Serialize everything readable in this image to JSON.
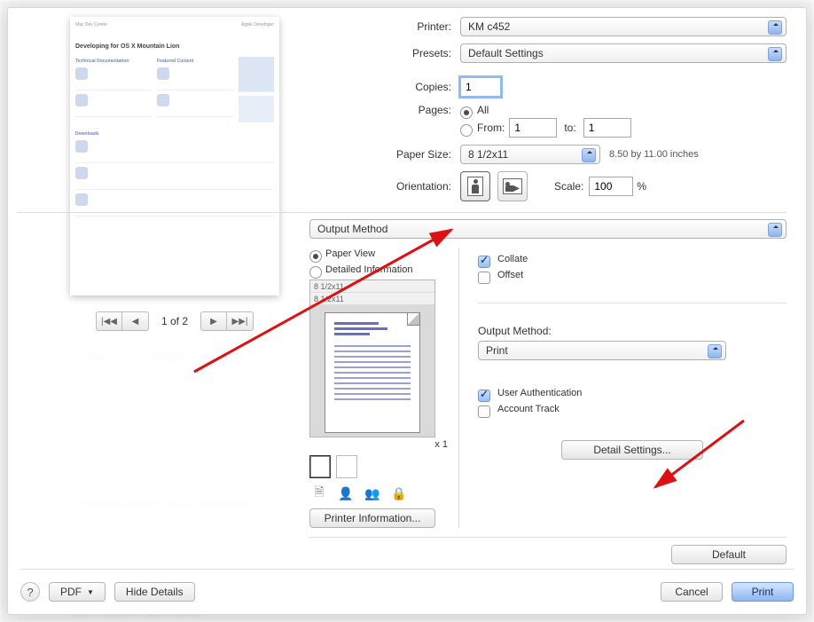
{
  "labels": {
    "printer": "Printer:",
    "presets": "Presets:",
    "copies": "Copies:",
    "pages": "Pages:",
    "all": "All",
    "from": "From:",
    "to": "to:",
    "paper_size": "Paper Size:",
    "orientation": "Orientation:",
    "scale": "Scale:",
    "percent": "%",
    "paper_view": "Paper View",
    "detailed_info": "Detailed Information",
    "output_method_label": "Output Method:",
    "collate": "Collate",
    "offset": "Offset",
    "user_auth": "User Authentication",
    "account_track": "Account Track",
    "paper_dim_note": "8.50 by 11.00 inches"
  },
  "values": {
    "printer": "KM c452",
    "presets": "Default Settings",
    "copies": "1",
    "pages_mode": "all",
    "from": "1",
    "to": "1",
    "paper_size": "8 1/2x11",
    "scale": "100",
    "section": "Output Method",
    "paper_view_mode": "paper_view",
    "paper_view_size1": "8 1/2x11",
    "paper_view_size2": "8 1/2x11",
    "x_count": "x 1",
    "output_method": "Print",
    "collate": true,
    "offset": false,
    "user_auth": true,
    "account_track": false,
    "page_indicator": "1 of 2"
  },
  "buttons": {
    "printer_info": "Printer Information...",
    "detail_settings": "Detail Settings...",
    "default": "Default",
    "pdf": "PDF",
    "hide_details": "Hide Details",
    "cancel": "Cancel",
    "print": "Print"
  },
  "preview": {
    "doc_title": "Developing for OS X Mountain Lion",
    "header_left": "Mac Dev Center",
    "section1": "Technical Documentation",
    "section2": "Featured Content",
    "downloads": "Downloads"
  },
  "background": {
    "t1": "Xcode 4.5 Developer Preview",
    "t2": "OS X Mountain Lion GM Seed",
    "t3": "OS X Server GM Seed"
  }
}
